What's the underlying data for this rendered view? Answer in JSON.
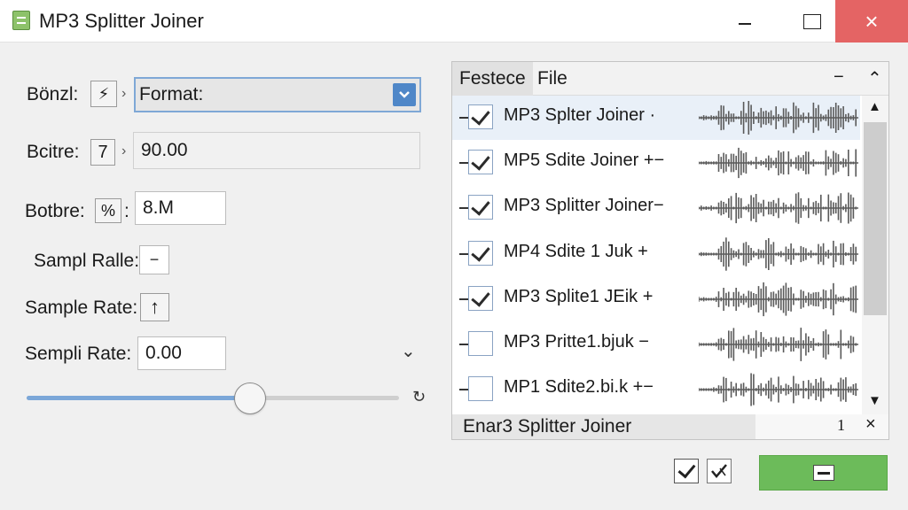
{
  "window": {
    "title": "MP3 Splitter Joiner",
    "close_glyph": "×"
  },
  "form": {
    "row1": {
      "label": "Bönzl:",
      "box_glyph": "⚡",
      "select_value": "Format:"
    },
    "row2": {
      "label": "Bcitre:",
      "box_value": "7",
      "field_value": "90.00"
    },
    "row3": {
      "label": "Botbre:",
      "box_glyph": "%",
      "colon": ":",
      "field_value": "8.M"
    },
    "row4": {
      "label": "Sampl Ralle:",
      "box_glyph": "−"
    },
    "row5": {
      "label": "Sample Rate:",
      "box_glyph": "↑"
    },
    "row6": {
      "label": "Sempli Rate:",
      "field_value": "0.00",
      "chevron": "⌄"
    },
    "slider": {
      "value_fraction": 0.6,
      "refresh_glyph": "↻"
    }
  },
  "list_panel": {
    "tabs": [
      "Festece",
      "File"
    ],
    "header_menu_glyph": "−",
    "header_collapse_glyph": "⌃",
    "rows": [
      {
        "label": "MP3 Splter Joiner ·",
        "checked": true,
        "selected": true
      },
      {
        "label": "MP5 Sdite Joiner +−",
        "checked": true,
        "selected": false
      },
      {
        "label": "MP3 Splitter Joiner−",
        "checked": true,
        "selected": false
      },
      {
        "label": "MP4 Sdite 1 Juk +",
        "checked": true,
        "selected": false
      },
      {
        "label": "MP3 Splite1 JEik +",
        "checked": true,
        "selected": false
      },
      {
        "label": "MP3 Pritte1.bjuk −",
        "checked": false,
        "selected": false
      },
      {
        "label": "MP1 Sdite2.bi.k +−",
        "checked": false,
        "selected": false
      }
    ],
    "footer": {
      "text": "Enar3 Splitter Joiner",
      "count": "1",
      "close_glyph": "×"
    },
    "scroll_up_glyph": "▲",
    "scroll_down_glyph": "▼"
  },
  "colors": {
    "accent": "#4f87c8",
    "primary_button": "#6cbb5a",
    "close_button": "#e46464"
  }
}
